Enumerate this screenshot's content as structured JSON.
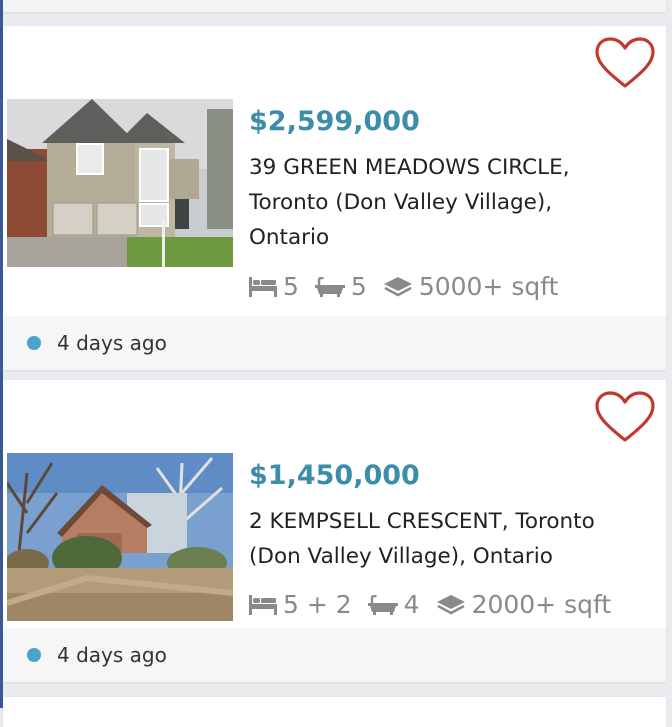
{
  "listings": [
    {
      "price": "$2,599,000",
      "address": "39 GREEN MEADOWS CIRCLE, Toronto (Don Valley Village), Ontario",
      "beds": "5",
      "baths": "5",
      "sqft": "5000+ sqft",
      "posted": "4 days ago"
    },
    {
      "price": "$1,450,000",
      "address": "2 KEMPSELL CRESCENT, Toronto (Don Valley Village), Ontario",
      "beds": "5 + 2",
      "baths": "4",
      "sqft": "2000+ sqft",
      "posted": "4 days ago"
    }
  ],
  "icons": {
    "favorite": "heart-outline-icon",
    "beds": "bed-icon",
    "baths": "bathtub-icon",
    "area": "layers-icon",
    "status": "status-dot"
  },
  "colors": {
    "price": "#3c8da8",
    "heart": "#c0392b",
    "status_dot": "#4aa3c8"
  }
}
